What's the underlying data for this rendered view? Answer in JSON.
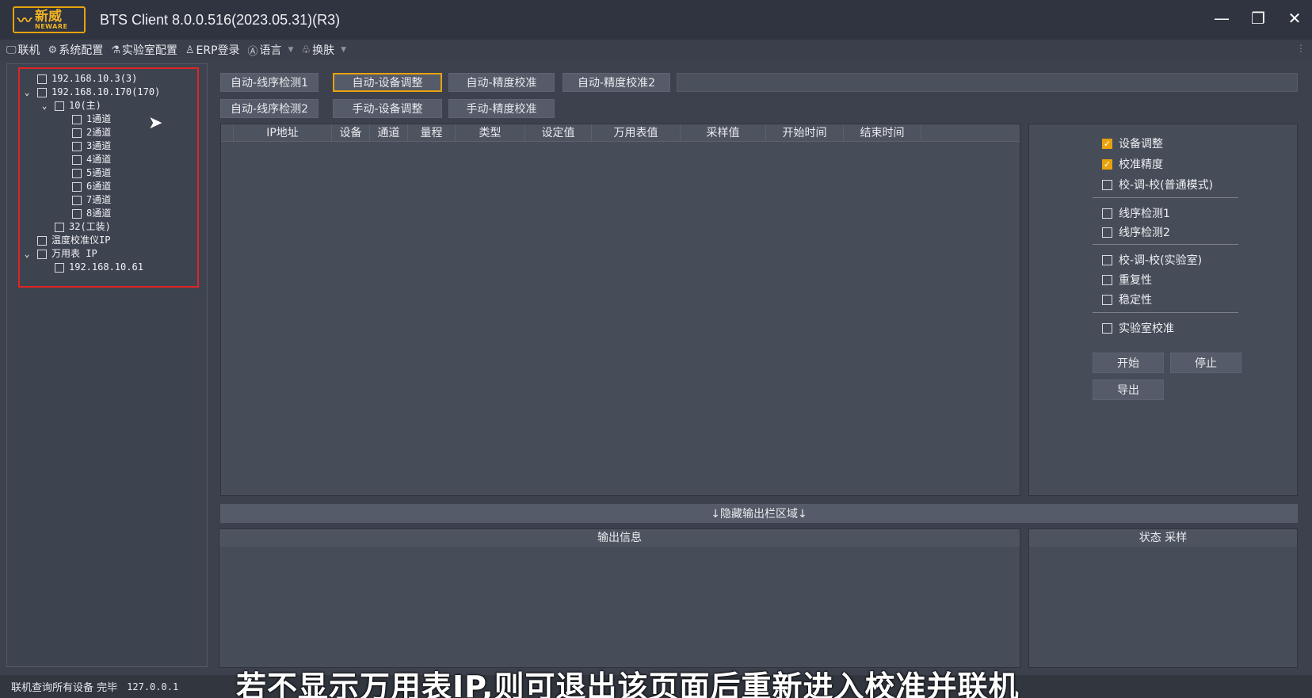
{
  "app": {
    "logo_cn": "新威",
    "logo_en": "NEWARE",
    "title": "BTS Client 8.0.0.516(2023.05.31)(R3)",
    "controls": {
      "minimize": "—",
      "restore": "❐",
      "close": "✕"
    }
  },
  "menu": [
    {
      "label": "联机",
      "icon": "monitor-icon"
    },
    {
      "label": "系统配置",
      "icon": "gear-icon"
    },
    {
      "label": "实验室配置",
      "icon": "flask-icon"
    },
    {
      "label": "ERP登录",
      "icon": "user-icon"
    },
    {
      "label": "语言",
      "icon": "language-icon"
    },
    {
      "label": "换肤",
      "icon": "shirt-icon"
    }
  ],
  "tree": [
    {
      "label": "192.168.10.3(3)",
      "level": 0,
      "expanded": false
    },
    {
      "label": "192.168.10.170(170)",
      "level": 0,
      "expanded": true
    },
    {
      "label": "10(主)",
      "level": 1,
      "expanded": true
    },
    {
      "label": "1通道",
      "level": 2
    },
    {
      "label": "2通道",
      "level": 2
    },
    {
      "label": "3通道",
      "level": 2
    },
    {
      "label": "4通道",
      "level": 2
    },
    {
      "label": "5通道",
      "level": 2
    },
    {
      "label": "6通道",
      "level": 2
    },
    {
      "label": "7通道",
      "level": 2
    },
    {
      "label": "8通道",
      "level": 2
    },
    {
      "label": "32(工装)",
      "level": 1
    },
    {
      "label": "温度校准仪IP",
      "level": 0
    },
    {
      "label": "万用表 IP",
      "level": 0,
      "expanded": true
    },
    {
      "label": "192.168.10.61",
      "level": 1
    }
  ],
  "mode_buttons": {
    "auto_wiring1": "自动-线序检测1",
    "auto_adjust": "自动-设备调整",
    "auto_precision": "自动-精度校准",
    "auto_precision2": "自动-精度校准2",
    "auto_wiring2": "自动-线序检测2",
    "manual_adjust": "手动-设备调整",
    "manual_precision": "手动-精度校准",
    "active": "auto_adjust"
  },
  "table": {
    "columns": [
      "IP地址",
      "设备",
      "通道",
      "量程",
      "类型",
      "设定值",
      "万用表值",
      "采样值",
      "开始时间",
      "结束时间"
    ]
  },
  "options": {
    "group1": [
      {
        "label": "设备调整",
        "checked": true
      },
      {
        "label": "校准精度",
        "checked": true
      },
      {
        "label": "校-调-校(普通模式)",
        "checked": false
      }
    ],
    "group2": [
      {
        "label": "线序检测1",
        "checked": false
      },
      {
        "label": "线序检测2",
        "checked": false
      }
    ],
    "group3": [
      {
        "label": "校-调-校(实验室)",
        "checked": false
      },
      {
        "label": "重复性",
        "checked": false
      },
      {
        "label": "稳定性",
        "checked": false
      }
    ],
    "group4": [
      {
        "label": "实验室校准",
        "checked": false
      }
    ],
    "start_label": "开始",
    "stop_label": "停止",
    "export_label": "导出"
  },
  "hide_bar": "↓隐藏输出栏区域↓",
  "output": {
    "info_header": "输出信息",
    "status_header": "状态 采样"
  },
  "status": {
    "text": "联机查询所有设备 完毕",
    "ip": "127.0.0.1"
  },
  "subtitle": "若不显示万用表IP,则可退出该页面后重新进入校准并联机",
  "colors": {
    "accent": "#e8a20c",
    "highlight": "#e02525",
    "background": "#3c414d"
  }
}
